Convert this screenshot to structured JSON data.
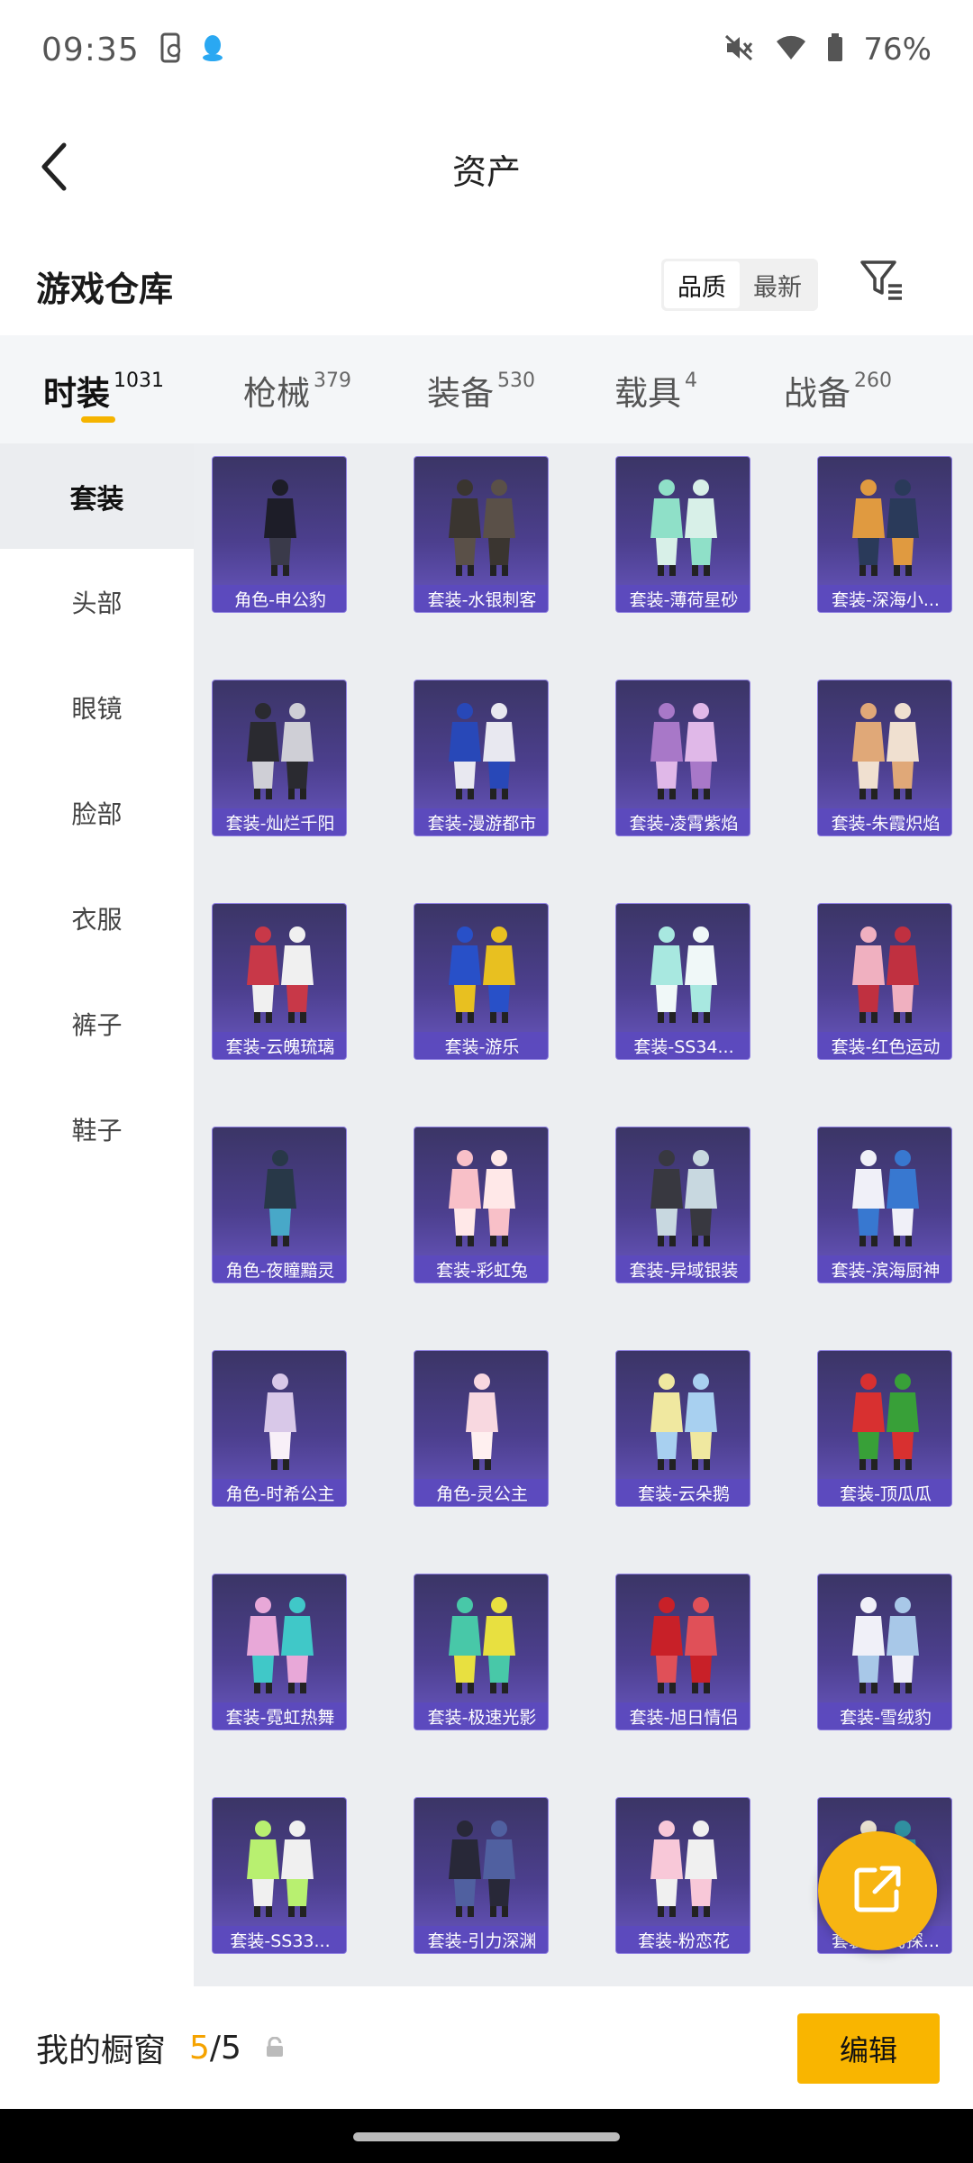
{
  "status_bar": {
    "time": "09:35",
    "battery": "76%"
  },
  "header": {
    "title": "资产"
  },
  "warehouse": {
    "title": "游戏仓库",
    "sort_options": [
      "品质",
      "最新"
    ],
    "active_sort": "品质"
  },
  "categories": [
    {
      "label": "时装",
      "count": "1031",
      "active": true
    },
    {
      "label": "枪械",
      "count": "379"
    },
    {
      "label": "装备",
      "count": "530"
    },
    {
      "label": "载具",
      "count": "4"
    },
    {
      "label": "战备",
      "count": "260"
    }
  ],
  "sidebar": {
    "items": [
      "套装",
      "头部",
      "眼镜",
      "脸部",
      "衣服",
      "裤子",
      "鞋子"
    ],
    "active": "套装"
  },
  "items": [
    "角色-申公豹",
    "套装-水银刺客",
    "套装-薄荷星砂",
    "套装-深海小...",
    "套装-灿烂千阳",
    "套装-漫游都市",
    "套装-凌霄紫焰",
    "套装-朱霞炽焰",
    "套装-云魄琉璃",
    "套装-游乐",
    "套装-SS34...",
    "套装-红色运动",
    "角色-夜瞳黯灵",
    "套装-彩虹兔",
    "套装-异域银装",
    "套装-滨海厨神",
    "角色-时希公主",
    "角色-灵公主",
    "套装-云朵鹅",
    "套装-顶瓜瓜",
    "套装-霓虹热舞",
    "套装-极速光影",
    "套装-旭日情侣",
    "套装-雪绒豹",
    "套装-SS33...",
    "套装-引力深渊",
    "套装-粉恋花",
    "套装-海岛探..."
  ],
  "bottom": {
    "label": "我的橱窗",
    "current": "5",
    "total": "/5",
    "edit_label": "编辑"
  },
  "colors": {
    "accent": "#f5b400",
    "card_name_bg": "#5c4abe",
    "card_bg": "#3b3566"
  },
  "icons": {
    "back": "chevron-left-icon",
    "filter": "filter-icon",
    "share": "share-external-icon",
    "lock": "lock-icon",
    "mute": "mute-icon",
    "wifi": "wifi-icon",
    "battery": "battery-icon"
  }
}
